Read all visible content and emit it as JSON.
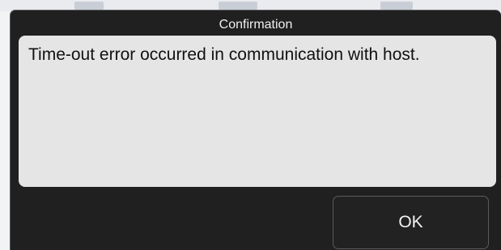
{
  "dialog": {
    "title": "Confirmation",
    "message": "Time-out error occurred in communication with host.",
    "ok_label": "OK"
  },
  "colors": {
    "dialog_background": "#202020",
    "message_panel": "#e5e5e5",
    "text_light": "#f0f0f0",
    "text_dark": "#111111"
  }
}
